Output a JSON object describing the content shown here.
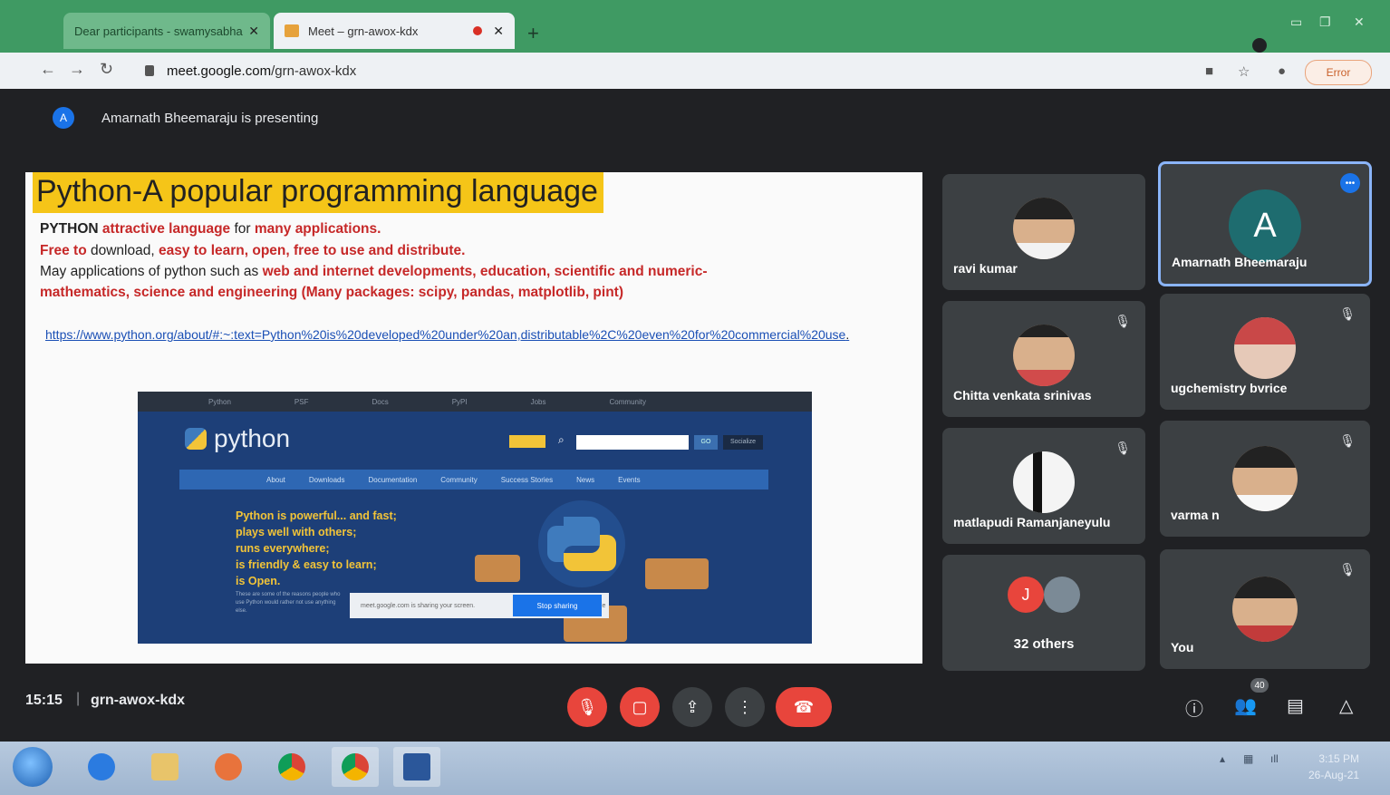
{
  "browser": {
    "tabs": [
      {
        "title": "Dear participants - swamysabha",
        "active": false
      },
      {
        "title": "Meet – grn-awox-kdx",
        "active": true
      }
    ],
    "url_host": "meet.google.com",
    "url_path": "/grn-awox-kdx",
    "error_label": "Error"
  },
  "meet": {
    "presenting_text": "Amarnath Bheemaraju is presenting",
    "presenter_initial": "A",
    "time": "15:15",
    "separator": "|",
    "meeting_code": "grn-awox-kdx",
    "people_count": "40",
    "participants": [
      {
        "name": "ravi kumar",
        "muted": false
      },
      {
        "name": "Amarnath Bheemaraju",
        "initial": "A",
        "speaking": true
      },
      {
        "name": "Chitta venkata srinivas",
        "muted": true
      },
      {
        "name": "ugchemistry bvrice",
        "muted": true
      },
      {
        "name": "matlapudi Ramanjaneyulu",
        "muted": true
      },
      {
        "name": "varma n",
        "muted": true
      },
      {
        "name": "32 others",
        "initial": "J"
      },
      {
        "name": "You",
        "muted": true
      }
    ]
  },
  "slide": {
    "title": "Python-A popular programming language",
    "line1": {
      "a": "PYTHON ",
      "b": "attractive language",
      "c": " for ",
      "d": "many applications."
    },
    "line2": {
      "a": "Free to",
      "b": " download, ",
      "c": "easy to learn, open, free to use and distribute."
    },
    "line3": {
      "a": "May applications of python such as ",
      "b": "web and internet developments, education, scientific and numeric-"
    },
    "line4": "mathematics, science and engineering (Many packages: scipy, pandas, matplotlib, pint)",
    "link": "https://www.python.org/about/#:~:text=Python%20is%20developed%20under%20an,distributable%2C%20even%20for%20commercial%20use",
    "link_tail": ".",
    "screenshot": {
      "top_nav": [
        "Python",
        "PSF",
        "Docs",
        "PyPI",
        "Jobs",
        "Community"
      ],
      "logo_text": "python",
      "go_label": "GO",
      "socialize_label": "Socialize",
      "menu": [
        "About",
        "Downloads",
        "Documentation",
        "Community",
        "Success Stories",
        "News",
        "Events"
      ],
      "tagline": [
        "Python is powerful... and fast;",
        "plays well with others;",
        "runs everywhere;",
        "is friendly & easy to learn;",
        "is Open."
      ],
      "fineprint": "These are some of the reasons people who use Python would rather not use anything else.",
      "share_text": "meet.google.com is sharing your screen.",
      "stop_label": "Stop sharing",
      "hide_label": "Hide"
    }
  },
  "taskbar": {
    "clock_time": "3:15 PM",
    "clock_date": "26-Aug-21"
  },
  "colors": {
    "chrome_green": "#3f9a63",
    "meet_bg": "#202124",
    "end_call_red": "#e8453c",
    "title_highlight": "#f5c518"
  }
}
